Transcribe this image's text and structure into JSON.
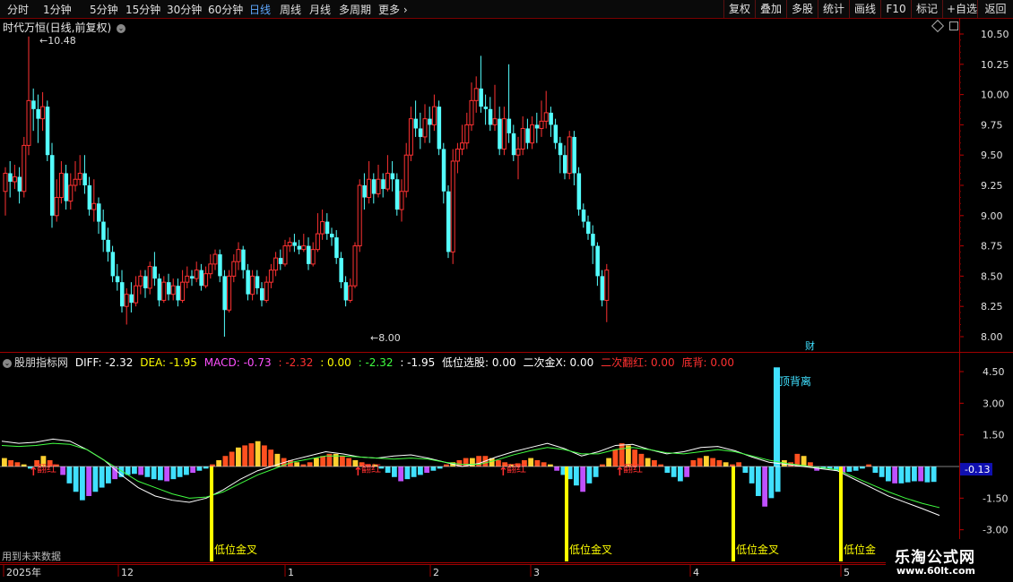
{
  "toolbar": {
    "periods": [
      "分时",
      "1分钟",
      "5分钟",
      "15分钟",
      "30分钟",
      "60分钟",
      "日线",
      "周线",
      "月线",
      "多周期",
      "更多"
    ],
    "active_period": "日线",
    "more_icon": "chevron-right-icon",
    "right_buttons": [
      "复权",
      "叠加",
      "多股",
      "统计",
      "画线",
      "F10",
      "标记",
      "+自选",
      "返回"
    ]
  },
  "main_chart": {
    "title": "时代万恒(日线,前复权)",
    "title_icon": "chevron-down-icon",
    "high_label": "10.48",
    "low_label": "8.00",
    "fin_marker": "财",
    "price_ticks": [
      "10.50",
      "10.25",
      "10.00",
      "9.75",
      "9.50",
      "9.25",
      "9.00",
      "8.75",
      "8.50",
      "8.25",
      "8.00"
    ],
    "colors": {
      "up": "#ff3232",
      "down": "#54ffff",
      "grid": "#7a0000"
    }
  },
  "indicator": {
    "name": "股朋指标网",
    "items": [
      {
        "label": "DIFF:",
        "value": "-2.32",
        "color": "#ffffff"
      },
      {
        "label": "DEA:",
        "value": "-1.95",
        "color": "#ffff00"
      },
      {
        "label": "MACD:",
        "value": "-0.73",
        "color": "#ff50ff"
      },
      {
        "label": ":",
        "value": "-2.32",
        "color": "#ff3030"
      },
      {
        "label": ":",
        "value": "0.00",
        "color": "#ffff00"
      },
      {
        "label": ":",
        "value": "-2.32",
        "color": "#40ff40"
      },
      {
        "label": ":",
        "value": "-1.95",
        "color": "#ffffff"
      },
      {
        "label": "低位选股:",
        "value": "0.00",
        "color": "#ffffff"
      },
      {
        "label": "二次金X:",
        "value": "0.00",
        "color": "#ffffff"
      },
      {
        "label": "二次翻红:",
        "value": "0.00",
        "color": "#ff3030"
      },
      {
        "label": "底背:",
        "value": "0.00",
        "color": "#ff3030"
      }
    ],
    "ticks": [
      "4.50",
      "3.00",
      "1.50",
      "-1.50",
      "-3.00"
    ],
    "current_value": "-0.13",
    "annotations": {
      "top_divergence": "顶背离",
      "flip_red": "翻红",
      "low_golden_cross": "低位金叉",
      "low_golden_partial": "低位金"
    },
    "colors": {
      "pos": "#ff5020",
      "pos_light": "#ffd030",
      "neg": "#40e0ff",
      "neg2": "#c050ff",
      "signal": "#ffff00",
      "top_bar": "#40e0ff"
    }
  },
  "date_axis": {
    "labels": [
      "2025年",
      "12",
      "1",
      "2",
      "3",
      "4",
      "5"
    ]
  },
  "footer_note": "用到未来数据",
  "watermark": {
    "title": "乐淘公式网",
    "url": "www.60lt.com"
  }
}
